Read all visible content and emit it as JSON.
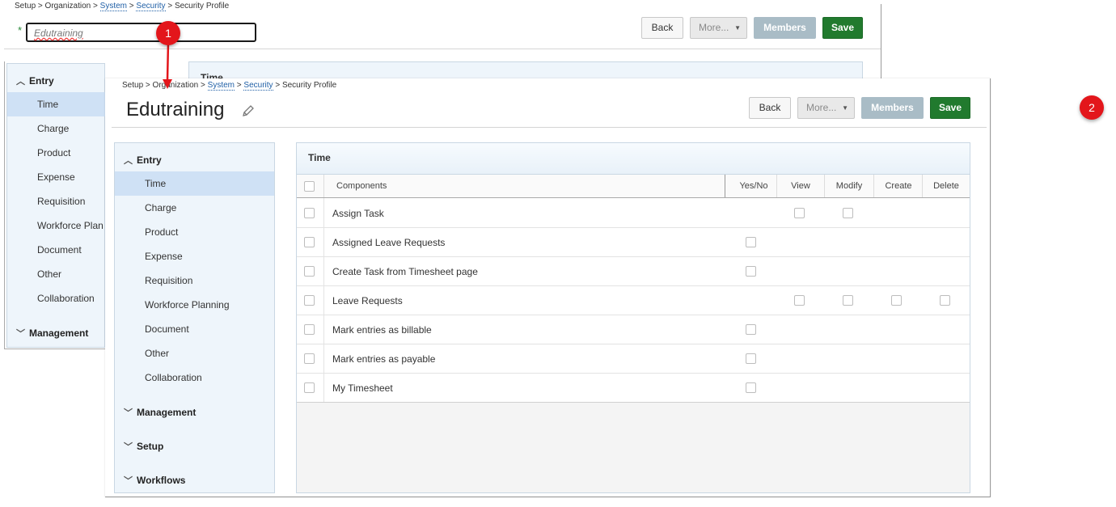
{
  "back_window": {
    "breadcrumb": {
      "setup": "Setup",
      "organization": "Organization",
      "system": "System",
      "security": "Security",
      "current": "Security Profile",
      "sep": ">"
    },
    "required_mark": "*",
    "name_input_value": "Edutraining",
    "buttons": {
      "back": "Back",
      "more": "More...",
      "members": "Members",
      "save": "Save"
    },
    "panel_title": "Time",
    "nav": {
      "entry": "Entry",
      "items": [
        "Time",
        "Charge",
        "Product",
        "Expense",
        "Requisition",
        "Workforce Plan",
        "Document",
        "Other",
        "Collaboration"
      ],
      "management": "Management"
    }
  },
  "front_window": {
    "breadcrumb": {
      "setup": "Setup",
      "organization": "Organization",
      "system": "System",
      "security": "Security",
      "current": "Security Profile",
      "sep": ">"
    },
    "title": "Edutraining",
    "buttons": {
      "back": "Back",
      "more": "More...",
      "members": "Members",
      "save": "Save"
    },
    "nav": {
      "entry": "Entry",
      "items": [
        "Time",
        "Charge",
        "Product",
        "Expense",
        "Requisition",
        "Workforce Planning",
        "Document",
        "Other",
        "Collaboration"
      ],
      "sections": [
        "Management",
        "Setup",
        "Workflows"
      ]
    },
    "panel": {
      "title": "Time",
      "columns": {
        "components": "Components",
        "yesno": "Yes/No",
        "view": "View",
        "modify": "Modify",
        "create": "Create",
        "delete": "Delete"
      },
      "rows": [
        {
          "label": "Assign Task"
        },
        {
          "label": "Assigned Leave Requests"
        },
        {
          "label": "Create Task from Timesheet page"
        },
        {
          "label": "Leave Requests"
        },
        {
          "label": "Mark entries as billable"
        },
        {
          "label": "Mark entries as payable"
        },
        {
          "label": "My Timesheet"
        }
      ]
    }
  },
  "annotations": {
    "step1": "1",
    "step2": "2"
  },
  "colors": {
    "accent_red": "#e3161b",
    "save_green": "#217a2e",
    "members_gray": "#a9bcc6",
    "selected_nav": "#cfe1f5"
  }
}
